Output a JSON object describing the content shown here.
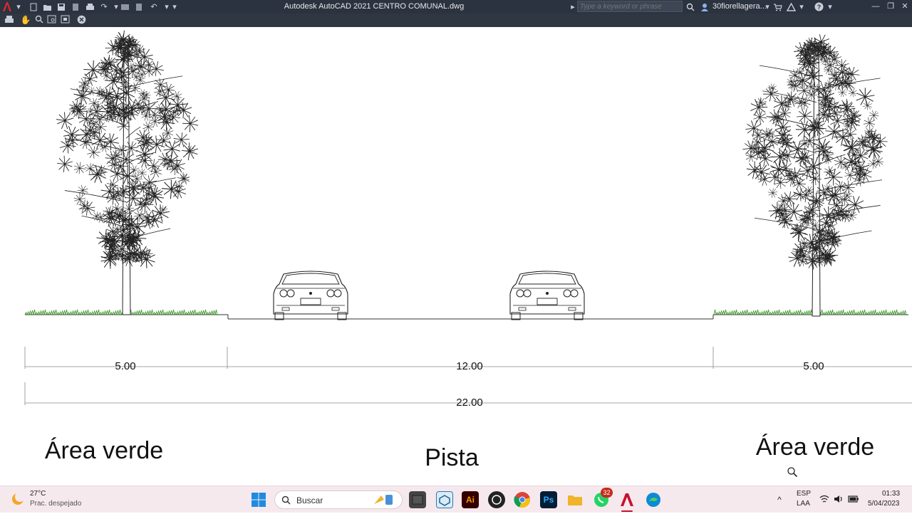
{
  "titlebar": {
    "title": "Autodesk AutoCAD 2021    CENTRO COMUNAL.dwg",
    "search_placeholder": "Type a keyword or phrase",
    "user": "30fiorellagera..."
  },
  "drawing": {
    "dimensions": {
      "left": "5.00",
      "center": "12.00",
      "right": "5.00",
      "total": "22.00"
    },
    "zones": {
      "left": "Área verde",
      "center": "Pista",
      "right": "Área verde"
    }
  },
  "taskbar": {
    "weather_temp": "27°C",
    "weather_desc": "Prac. despejado",
    "search_label": "Buscar",
    "whatsapp_badge": "32",
    "lang_primary": "ESP",
    "lang_secondary": "LAA",
    "time": "01:33",
    "date": "5/04/2023"
  },
  "colors": {
    "titlebar_bg": "#2b3340",
    "navbar_bg": "#2f3743",
    "autocad_red": "#e0282e",
    "grass": "#3e9a2b",
    "taskbar_bg": "#f6e9ee"
  }
}
